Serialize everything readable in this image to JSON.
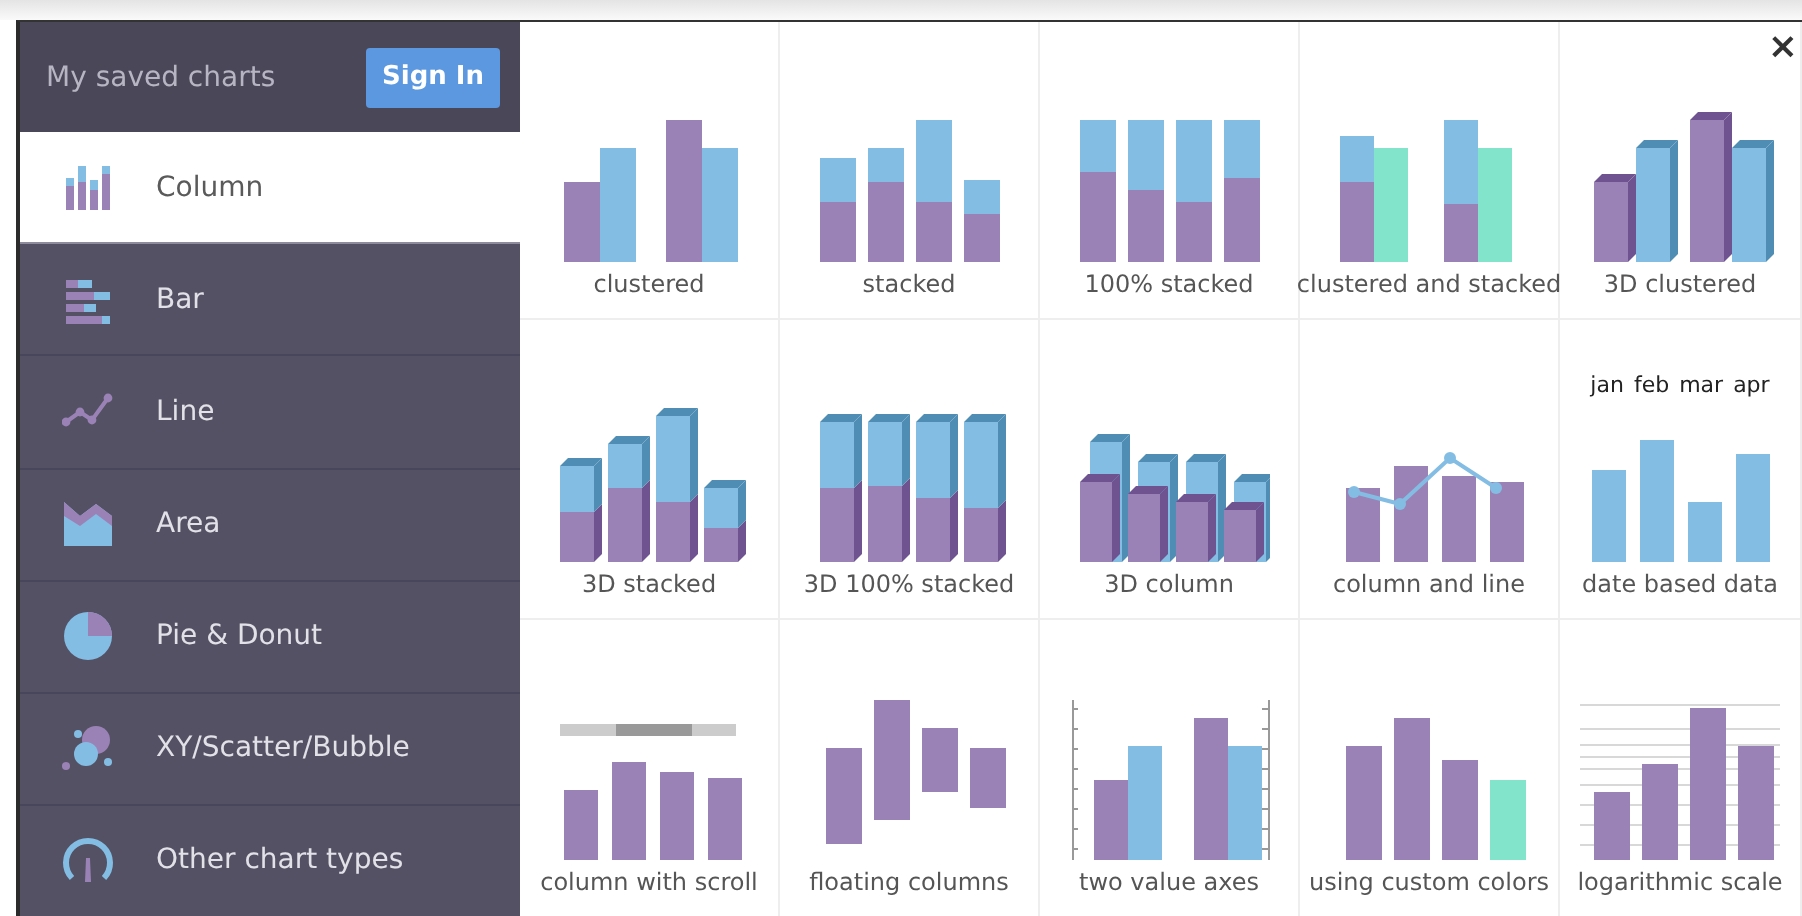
{
  "sidebar": {
    "header": {
      "title": "My saved charts",
      "button": "Sign In"
    },
    "items": [
      {
        "label": "Column",
        "kind": "column",
        "selected": true
      },
      {
        "label": "Bar",
        "kind": "bar",
        "selected": false
      },
      {
        "label": "Line",
        "kind": "line",
        "selected": false
      },
      {
        "label": "Area",
        "kind": "area",
        "selected": false
      },
      {
        "label": "Pie & Donut",
        "kind": "pie",
        "selected": false
      },
      {
        "label": "XY/Scatter/Bubble",
        "kind": "scatter",
        "selected": false
      },
      {
        "label": "Other chart types",
        "kind": "other",
        "selected": false
      }
    ]
  },
  "close": "×",
  "tiles": [
    {
      "label": "clustered",
      "kind": "clustered"
    },
    {
      "label": "stacked",
      "kind": "stacked"
    },
    {
      "label": "100% stacked",
      "kind": "percent"
    },
    {
      "label": "clustered and stacked",
      "kind": "mixed"
    },
    {
      "label": "3D clustered",
      "kind": "clusteredthree"
    },
    {
      "label": "3D stacked",
      "kind": "stackedthree"
    },
    {
      "label": "3D 100% stacked",
      "kind": "percentthree"
    },
    {
      "label": "3D column",
      "kind": "columnthree"
    },
    {
      "label": "column and line",
      "kind": "combo"
    },
    {
      "label": "date based data",
      "kind": "dated",
      "months": [
        "jan",
        "feb",
        "mar",
        "apr"
      ]
    },
    {
      "label": "column with scroll",
      "kind": "scroll"
    },
    {
      "label": "floating columns",
      "kind": "floating"
    },
    {
      "label": "two value axes",
      "kind": "dualaxis"
    },
    {
      "label": "using custom colors",
      "kind": "custom"
    },
    {
      "label": "logarithmic scale",
      "kind": "logarithmic"
    }
  ]
}
